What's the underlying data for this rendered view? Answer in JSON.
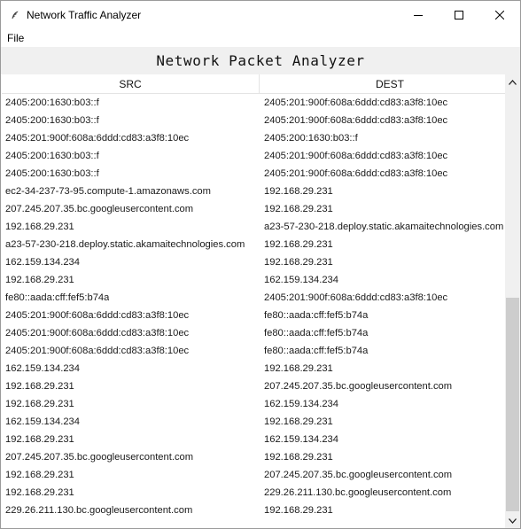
{
  "window": {
    "title": "Network Traffic Analyzer",
    "icon": "feather-app-icon"
  },
  "menu": {
    "items": [
      "File"
    ]
  },
  "banner": {
    "title": "Network Packet Analyzer"
  },
  "table": {
    "columns": [
      "SRC",
      "DEST"
    ],
    "rows": [
      [
        "2405:200:1630:b03::f",
        "2405:201:900f:608a:6ddd:cd83:a3f8:10ec"
      ],
      [
        "2405:200:1630:b03::f",
        "2405:201:900f:608a:6ddd:cd83:a3f8:10ec"
      ],
      [
        "2405:201:900f:608a:6ddd:cd83:a3f8:10ec",
        "2405:200:1630:b03::f"
      ],
      [
        "2405:200:1630:b03::f",
        "2405:201:900f:608a:6ddd:cd83:a3f8:10ec"
      ],
      [
        "2405:200:1630:b03::f",
        "2405:201:900f:608a:6ddd:cd83:a3f8:10ec"
      ],
      [
        "ec2-34-237-73-95.compute-1.amazonaws.com",
        "192.168.29.231"
      ],
      [
        "207.245.207.35.bc.googleusercontent.com",
        "192.168.29.231"
      ],
      [
        "192.168.29.231",
        "a23-57-230-218.deploy.static.akamaitechnologies.com"
      ],
      [
        "a23-57-230-218.deploy.static.akamaitechnologies.com",
        "192.168.29.231"
      ],
      [
        "162.159.134.234",
        "192.168.29.231"
      ],
      [
        "192.168.29.231",
        "162.159.134.234"
      ],
      [
        "fe80::aada:cff:fef5:b74a",
        "2405:201:900f:608a:6ddd:cd83:a3f8:10ec"
      ],
      [
        "2405:201:900f:608a:6ddd:cd83:a3f8:10ec",
        "fe80::aada:cff:fef5:b74a"
      ],
      [
        "2405:201:900f:608a:6ddd:cd83:a3f8:10ec",
        "fe80::aada:cff:fef5:b74a"
      ],
      [
        "2405:201:900f:608a:6ddd:cd83:a3f8:10ec",
        "fe80::aada:cff:fef5:b74a"
      ],
      [
        "162.159.134.234",
        "192.168.29.231"
      ],
      [
        "192.168.29.231",
        "207.245.207.35.bc.googleusercontent.com"
      ],
      [
        "192.168.29.231",
        "162.159.134.234"
      ],
      [
        "162.159.134.234",
        "192.168.29.231"
      ],
      [
        "192.168.29.231",
        "162.159.134.234"
      ],
      [
        "207.245.207.35.bc.googleusercontent.com",
        "192.168.29.231"
      ],
      [
        "192.168.29.231",
        "207.245.207.35.bc.googleusercontent.com"
      ],
      [
        "192.168.29.231",
        "229.26.211.130.bc.googleusercontent.com"
      ],
      [
        "229.26.211.130.bc.googleusercontent.com",
        "192.168.29.231"
      ]
    ]
  },
  "scrollbar": {
    "icons": [
      "scroll-up-arrow-icon",
      "scroll-down-arrow-icon"
    ]
  }
}
